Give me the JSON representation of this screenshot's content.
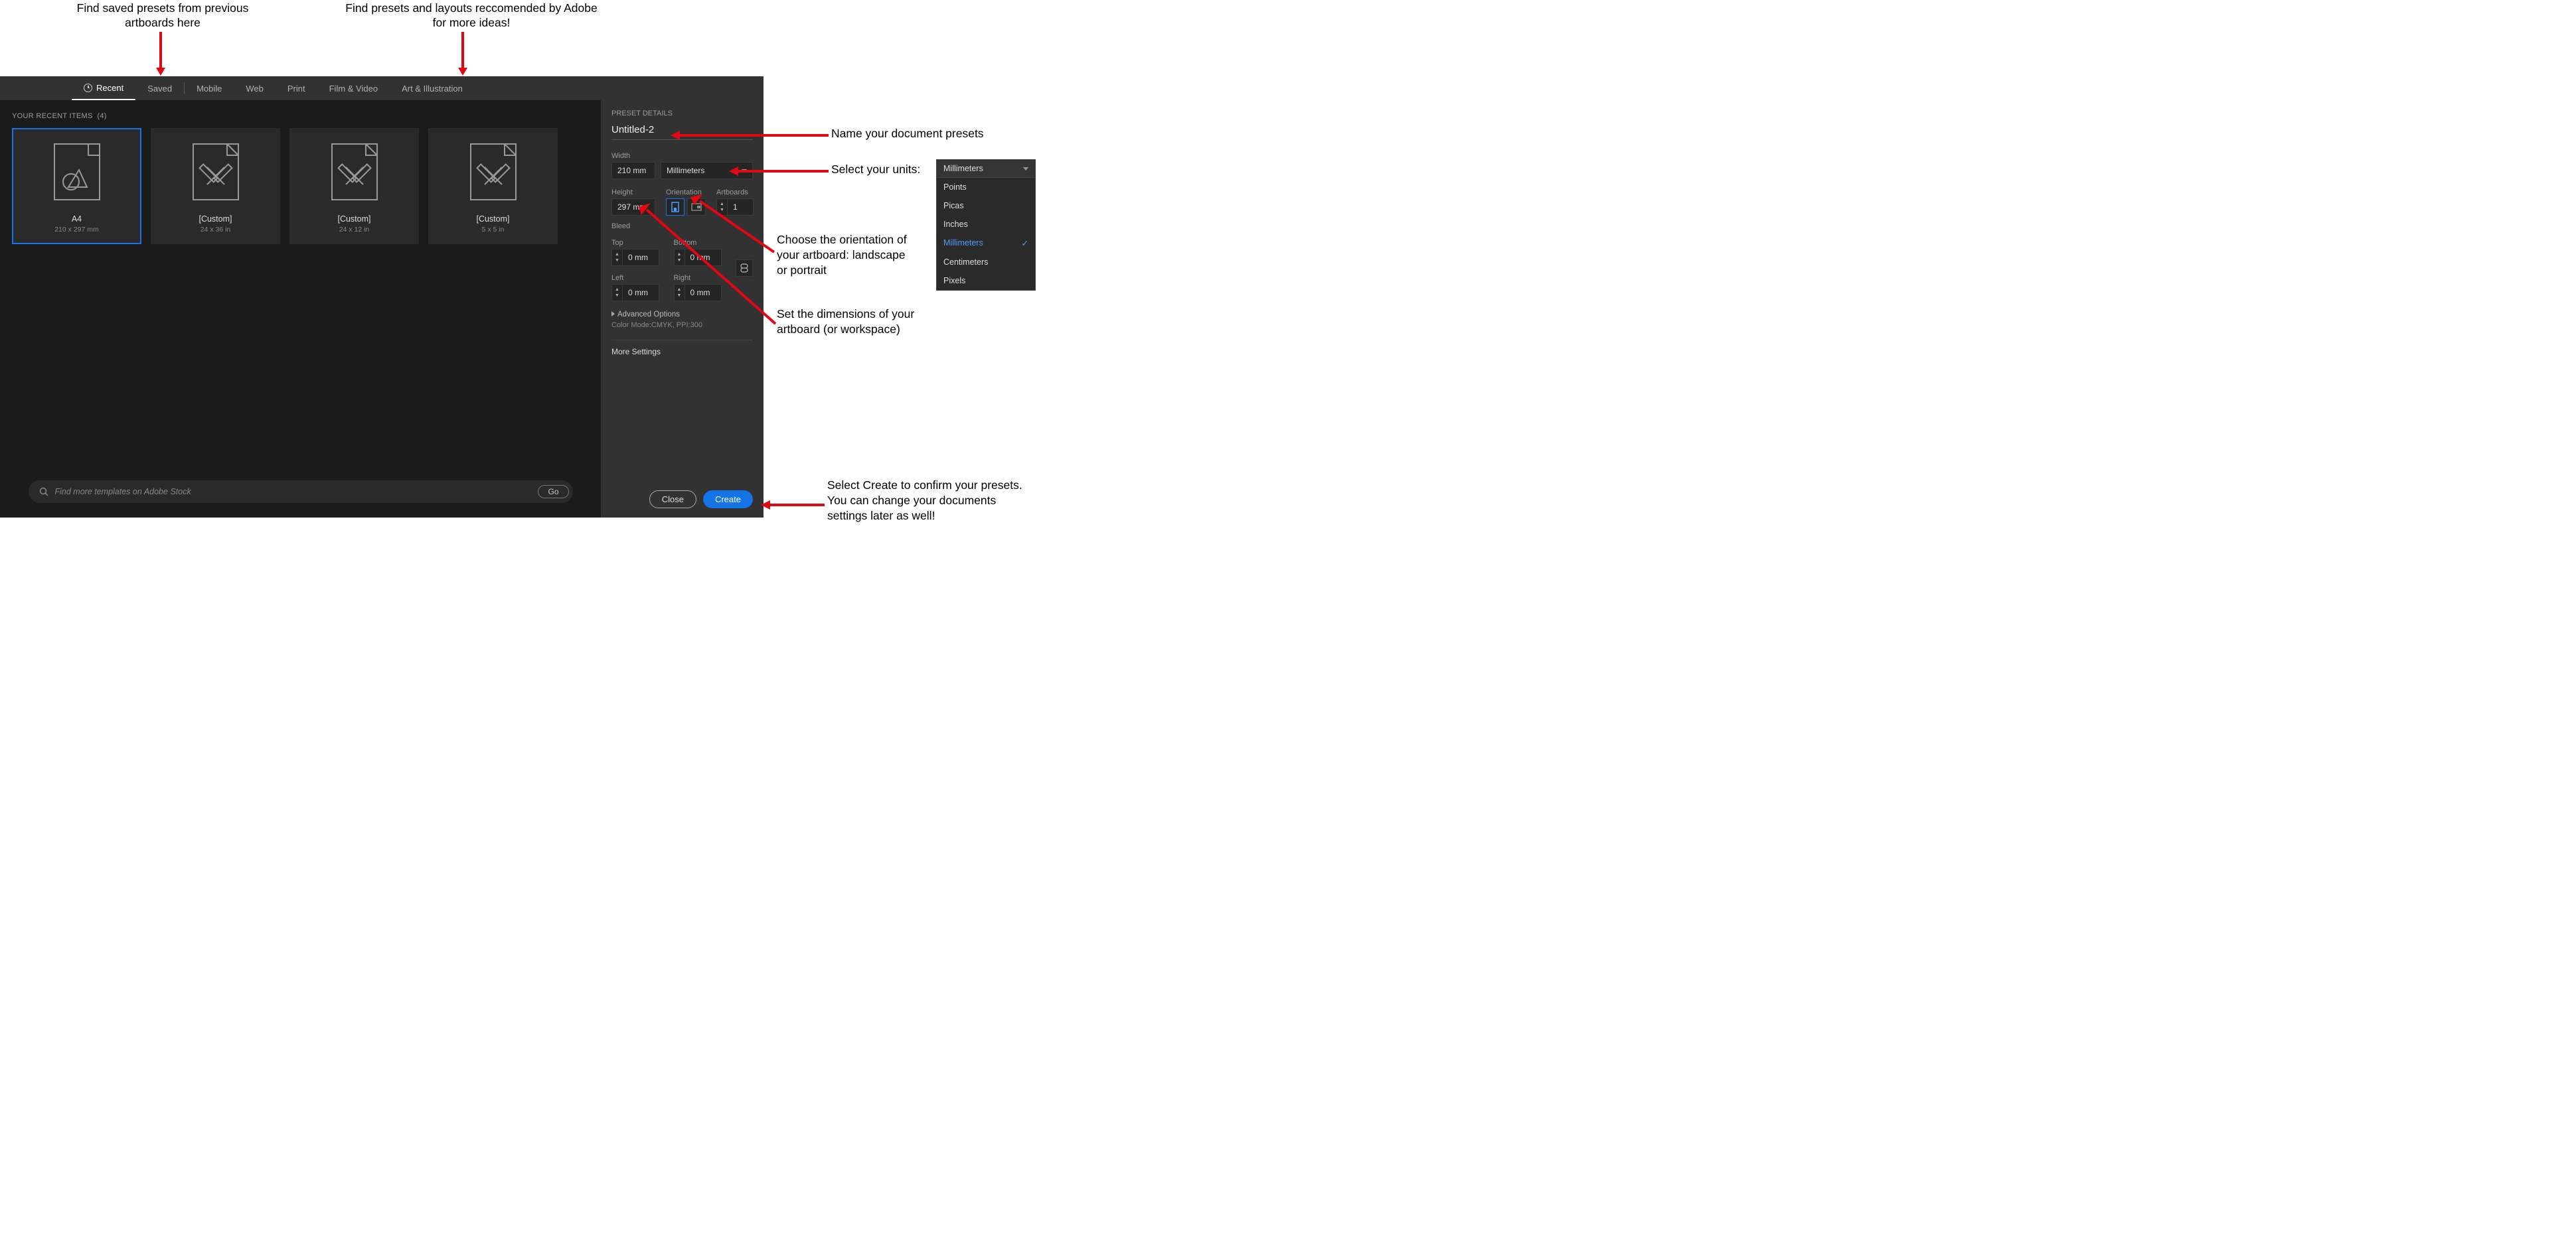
{
  "annotations": {
    "top_left": "Find saved presets from previous\nartboards here",
    "top_right": "Find presets and layouts reccomended\nby Adobe for more ideas!",
    "name": "Name your document presets",
    "units": "Select your units:",
    "orientation": "Choose the orientation of\nyour artboard: landscape\nor portrait",
    "dimensions": "Set the dimensions of your\nartboard (or workspace)",
    "create": "Select Create to confirm your presets.\nYou can change your documents\nsettings later as well!"
  },
  "tabs": [
    "Recent",
    "Saved",
    "Mobile",
    "Web",
    "Print",
    "Film & Video",
    "Art & Illustration"
  ],
  "recent": {
    "header": "YOUR RECENT ITEMS",
    "count": "(4)",
    "items": [
      {
        "name": "A4",
        "dim": "210 x 297 mm"
      },
      {
        "name": "[Custom]",
        "dim": "24 x 36 in"
      },
      {
        "name": "[Custom]",
        "dim": "24 x 12 in"
      },
      {
        "name": "[Custom]",
        "dim": "5 x 5 in"
      }
    ]
  },
  "details": {
    "title": "PRESET DETAILS",
    "docname": "Untitled-2",
    "width_label": "Width",
    "width": "210 mm",
    "units": "Millimeters",
    "height_label": "Height",
    "height": "297 mm",
    "orientation_label": "Orientation",
    "artboards_label": "Artboards",
    "artboards": "1",
    "bleed_label": "Bleed",
    "top_label": "Top",
    "bottom_label": "Bottom",
    "left_label": "Left",
    "right_label": "Right",
    "bleed_val": "0 mm",
    "advanced": "Advanced Options",
    "colormode": "Color Mode:CMYK, PPI:300",
    "more": "More Settings"
  },
  "search_placeholder": "Find more templates on Adobe Stock",
  "go_label": "Go",
  "close_label": "Close",
  "create_label": "Create",
  "units_dropdown": {
    "header": "Millimeters",
    "options": [
      "Points",
      "Picas",
      "Inches",
      "Millimeters",
      "Centimeters",
      "Pixels"
    ],
    "selected": "Millimeters"
  }
}
